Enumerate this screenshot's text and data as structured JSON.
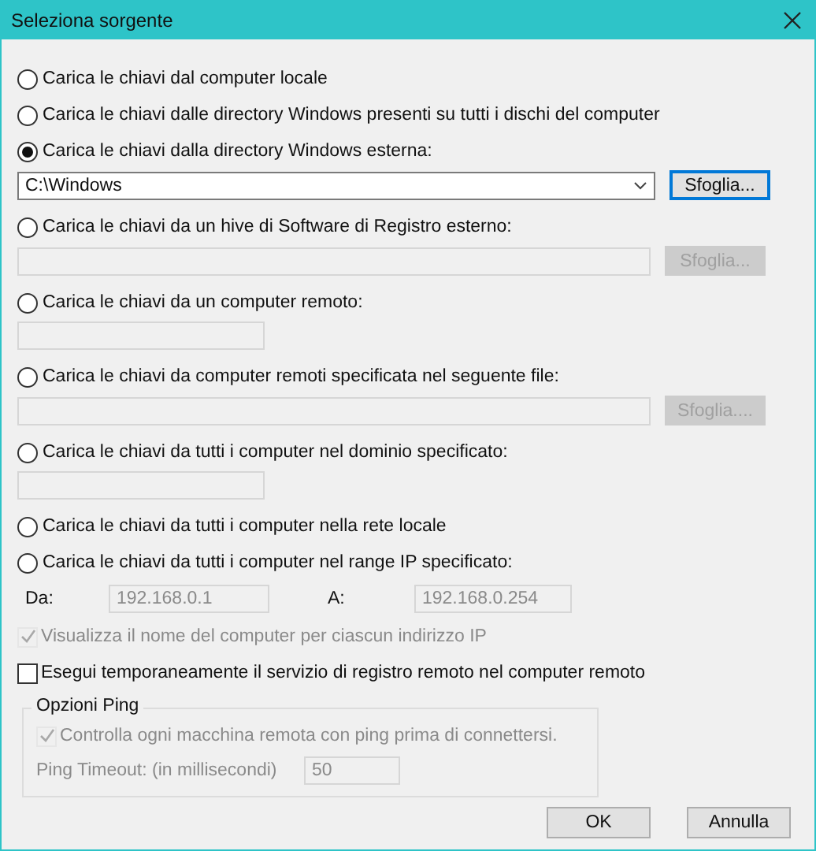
{
  "window": {
    "title": "Seleziona sorgente"
  },
  "options": [
    {
      "kind": "plain",
      "label": "Carica le chiavi dal computer locale",
      "selected": false
    },
    {
      "kind": "plain",
      "label": "Carica le chiavi dalle directory Windows presenti su tutti i dischi del computer",
      "selected": false
    },
    {
      "kind": "combo",
      "label": "Carica le chiavi dalla directory Windows esterna:",
      "selected": true,
      "value": "C:\\Windows",
      "button": "Sfoglia...",
      "disabled": false
    },
    {
      "kind": "path",
      "label": "Carica le chiavi da un hive di Software di Registro esterno:",
      "selected": false,
      "button": "Sfoglia...",
      "disabled": true
    },
    {
      "kind": "field",
      "label": "Carica le chiavi da un computer remoto:",
      "selected": false
    },
    {
      "kind": "path",
      "label": "Carica le chiavi da computer remoti specificata nel seguente file:",
      "selected": false,
      "button": "Sfoglia....",
      "disabled": true
    },
    {
      "kind": "field",
      "label": "Carica le chiavi da tutti i computer nel dominio specificato:",
      "selected": false
    },
    {
      "kind": "plain",
      "label": "Carica le chiavi da tutti i computer nella rete locale",
      "selected": false
    },
    {
      "kind": "plain",
      "label": "Carica le chiavi da tutti i computer nel range IP specificato:",
      "selected": false
    }
  ],
  "range": {
    "from_label": "Da:",
    "from_value": "192.168.0.1",
    "to_label": "A:",
    "to_value": "192.168.0.254",
    "disabled": true
  },
  "checkboxes": [
    {
      "label": "Visualizza il nome del computer per ciascun indirizzo IP",
      "checked": true,
      "disabled": true
    },
    {
      "label": "Esegui temporaneamente il servizio di registro remoto nel computer remoto",
      "checked": false,
      "disabled": false
    }
  ],
  "ping": {
    "title": "Opzioni Ping",
    "checkbox": {
      "label": "Controlla ogni macchina remota con ping prima di connettersi.",
      "checked": true,
      "disabled": true
    },
    "timeout_label": "Ping Timeout: (in millisecondi)",
    "timeout_value": "50",
    "disabled": true
  },
  "buttons": [
    {
      "label": "OK"
    },
    {
      "label": "Annulla"
    }
  ]
}
